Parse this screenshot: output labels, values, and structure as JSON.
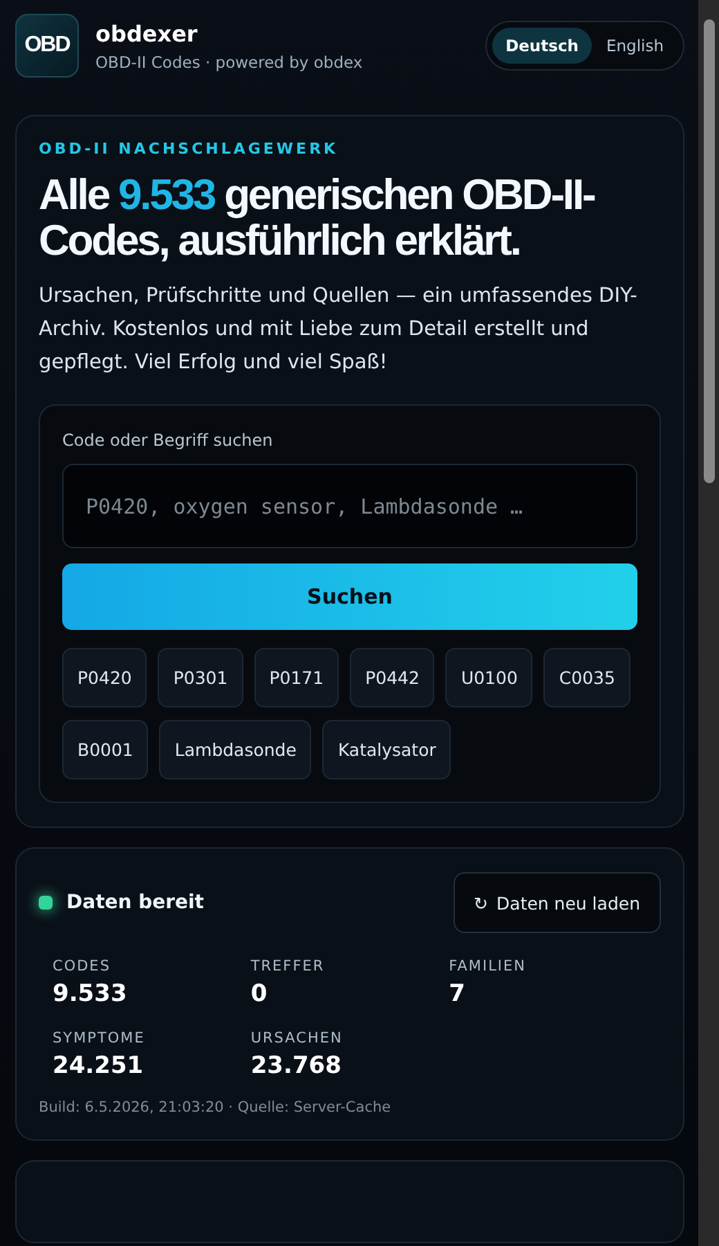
{
  "header": {
    "logo": "OBD",
    "title": "obdexer",
    "subtitle": "OBD-II Codes · powered by obdex"
  },
  "languages": [
    {
      "label": "Deutsch",
      "selected": true
    },
    {
      "label": "English",
      "selected": false
    }
  ],
  "hero": {
    "eyebrow": "OBD-II NACHSCHLAGEWERK",
    "headline_before": "Alle",
    "headline_highlight": "9.533",
    "headline_after": "generischen OBD-II-Codes, ausführlich erklärt.",
    "intro": "Ursachen, Prüfschritte und Quellen — ein umfassendes DIY-Archiv. Kostenlos und mit Liebe zum Detail erstellt und gepflegt. Viel Erfolg und viel Spaß!"
  },
  "search": {
    "label": "Code oder Begriff suchen",
    "placeholder": "P0420, oxygen sensor, Lambdasonde …",
    "button": "Suchen",
    "suggestions": [
      "P0420",
      "P0301",
      "P0171",
      "P0442",
      "U0100",
      "C0035",
      "B0001",
      "Lambdasonde",
      "Katalysator"
    ]
  },
  "status": {
    "ready": true,
    "label": "Daten bereit",
    "reload_icon": "↻",
    "reload": "Daten neu laden",
    "stats": [
      {
        "label": "CODES",
        "value": "9.533"
      },
      {
        "label": "TREFFER",
        "value": "0"
      },
      {
        "label": "FAMILIEN",
        "value": "7"
      },
      {
        "label": "SYMPTOME",
        "value": "24.251"
      },
      {
        "label": "URSACHEN",
        "value": "23.768"
      }
    ],
    "build": "Build: 6.5.2026, 21:03:20 · Quelle: Server-Cache"
  }
}
